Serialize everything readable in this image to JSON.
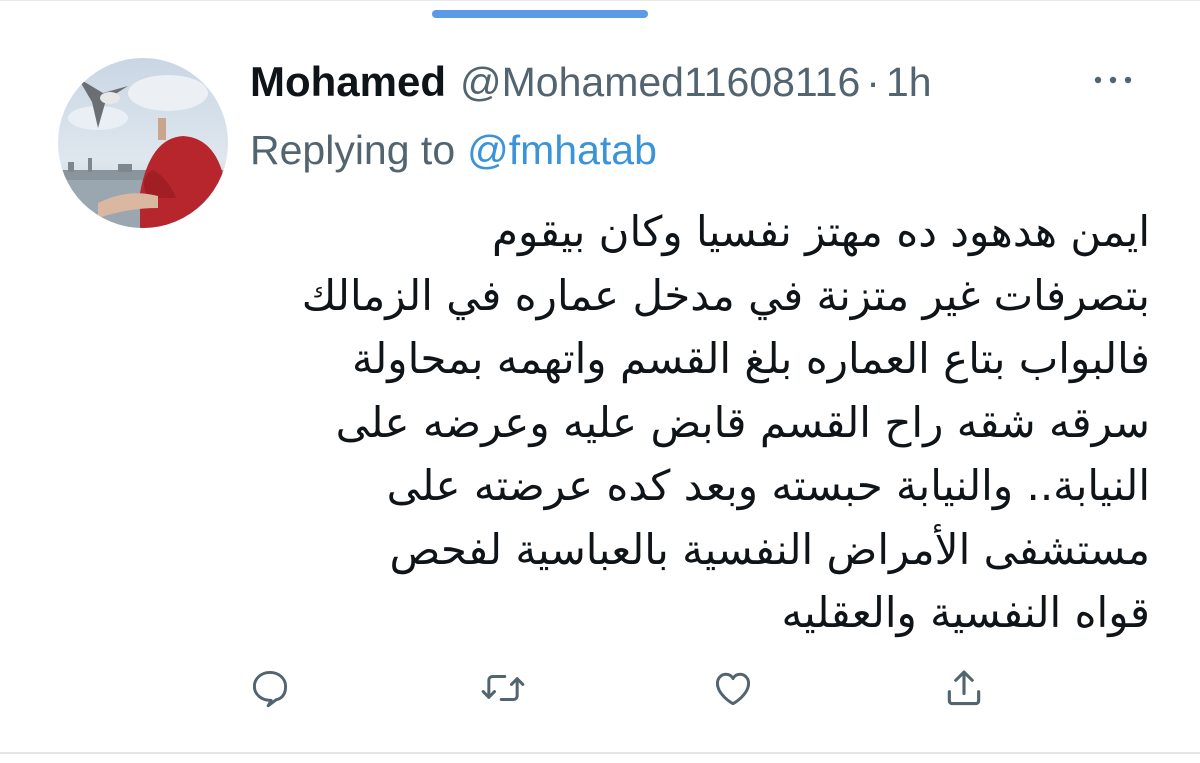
{
  "tweet": {
    "author": {
      "display_name": "Mohamed",
      "handle": "@Mohamed11608116",
      "separator": "·",
      "time": "1h"
    },
    "reply": {
      "prefix": "Replying to",
      "to_handle": "@fmhatab"
    },
    "body_lines": [
      "ايمن هدهود ده مهتز نفسيا وكان بيقوم",
      "بتصرفات غير متزنة في مدخل عماره في الزمالك",
      "فالبواب بتاع العماره بلغ القسم واتهمه بمحاولة",
      "سرقه شقه راح القسم قابض عليه وعرضه على",
      "النيابة.. والنيابة حبسته وبعد كده عرضته على",
      "مستشفى الأمراض النفسية بالعباسية لفحص",
      "قواه النفسية والعقليه"
    ],
    "actions": [
      {
        "name": "reply",
        "icon": "comment-icon"
      },
      {
        "name": "retweet",
        "icon": "retweet-icon"
      },
      {
        "name": "like",
        "icon": "heart-icon"
      },
      {
        "name": "share",
        "icon": "share-icon"
      }
    ]
  },
  "colors": {
    "text_primary": "#0f1419",
    "text_secondary": "#536471",
    "link": "#3b94d9",
    "handle_bar": "#5a9ae6"
  }
}
